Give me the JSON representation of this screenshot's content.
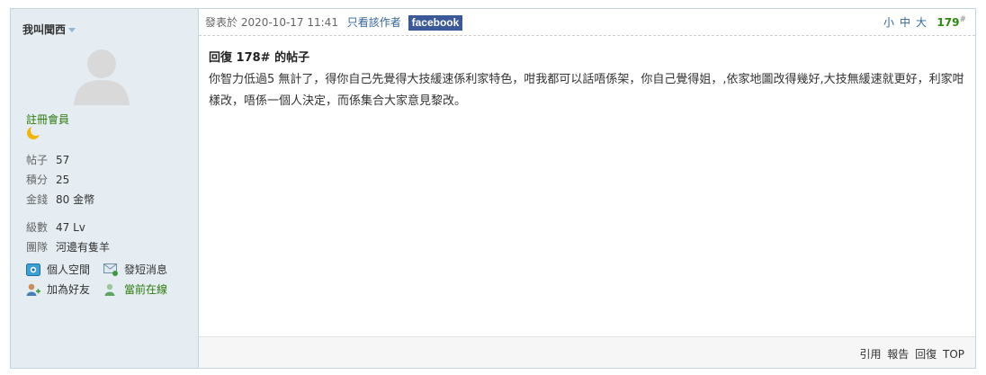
{
  "author": {
    "name": "我叫聞西"
  },
  "sidebar": {
    "group": "註冊會員",
    "stats": [
      {
        "label": "帖子",
        "value": "57"
      },
      {
        "label": "積分",
        "value": "25"
      },
      {
        "label": "金錢",
        "value": "80 金幣"
      }
    ],
    "stats2": [
      {
        "label": "級數",
        "value": "47 Lv"
      },
      {
        "label": "團隊",
        "value": "河邊有隻羊"
      }
    ],
    "actions": {
      "space": "個人空間",
      "message": "發短消息",
      "addfriend": "加為好友",
      "online": "當前在線"
    }
  },
  "post": {
    "posted_label": "發表於 2020-10-17 11:41",
    "only_author": "只看該作者",
    "facebook": "facebook",
    "font_sizes": "小中大",
    "floor": "179",
    "floor_mark": "#",
    "title": "回復 178# 的帖子",
    "body": "你智力低過5 無計了，得你自己先覺得大技緩速係利家特色，咁我都可以話唔係架，你自己覺得姐，,依家地圖改得幾好,大技無緩速就更好，利家咁樣改，唔係一個人決定，而係集合大家意見黎改。"
  },
  "footer": {
    "quote": "引用",
    "report": "報告",
    "reply": "回復",
    "top": "TOP"
  },
  "colors": {
    "accent": "#336699",
    "green": "#2b7a0b",
    "sidebar_bg": "#e5edf2",
    "border": "#c2d5e3",
    "facebook": "#3b5998"
  }
}
